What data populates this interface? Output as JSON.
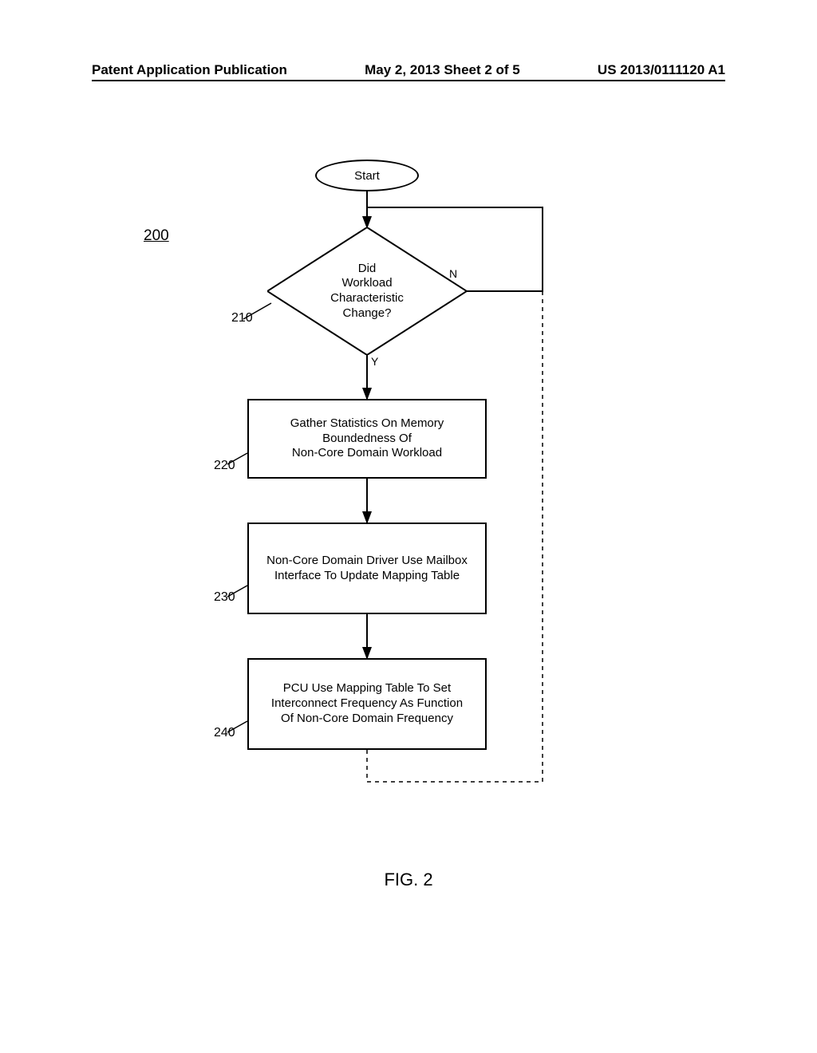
{
  "header": {
    "left": "Patent Application Publication",
    "center": "May 2, 2013  Sheet 2 of 5",
    "right": "US 2013/0111120 A1"
  },
  "figure_label": "FIG. 2",
  "ref_main": "200",
  "refs": {
    "r210": "210",
    "r220": "220",
    "r230": "230",
    "r240": "240"
  },
  "start": "Start",
  "diamond": {
    "l1": "Did",
    "l2": "Workload",
    "l3": "Characteristic",
    "l4": "Change?"
  },
  "branch": {
    "yes": "Y",
    "no": "N"
  },
  "box220": {
    "l1": "Gather Statistics On Memory",
    "l2": "Boundedness Of",
    "l3": "Non-Core Domain Workload"
  },
  "box230": {
    "l1": "Non-Core Domain Driver Use Mailbox",
    "l2": "Interface To Update Mapping Table"
  },
  "box240": {
    "l1": "PCU Use Mapping Table To Set",
    "l2": "Interconnect Frequency As Function",
    "l3": "Of Non-Core Domain Frequency"
  },
  "chart_data": {
    "type": "flowchart",
    "title": "FIG. 2",
    "reference_numeral": "200",
    "nodes": [
      {
        "id": "start",
        "ref": null,
        "type": "terminator",
        "text": "Start"
      },
      {
        "id": "n210",
        "ref": "210",
        "type": "decision",
        "text": "Did Workload Characteristic Change?"
      },
      {
        "id": "n220",
        "ref": "220",
        "type": "process",
        "text": "Gather Statistics On Memory Boundedness Of Non-Core Domain Workload"
      },
      {
        "id": "n230",
        "ref": "230",
        "type": "process",
        "text": "Non-Core Domain Driver Use Mailbox Interface To Update Mapping Table"
      },
      {
        "id": "n240",
        "ref": "240",
        "type": "process",
        "text": "PCU Use Mapping Table To Set Interconnect Frequency As Function Of Non-Core Domain Frequency"
      }
    ],
    "edges": [
      {
        "from": "start",
        "to": "n210",
        "label": null
      },
      {
        "from": "n210",
        "to": "n220",
        "label": "Y"
      },
      {
        "from": "n210",
        "to": "n210",
        "label": "N",
        "note": "loop back to decision input"
      },
      {
        "from": "n220",
        "to": "n230",
        "label": null
      },
      {
        "from": "n230",
        "to": "n240",
        "label": null
      },
      {
        "from": "n240",
        "to": "n210",
        "label": null,
        "note": "dashed feedback loop",
        "style": "dashed"
      }
    ]
  }
}
